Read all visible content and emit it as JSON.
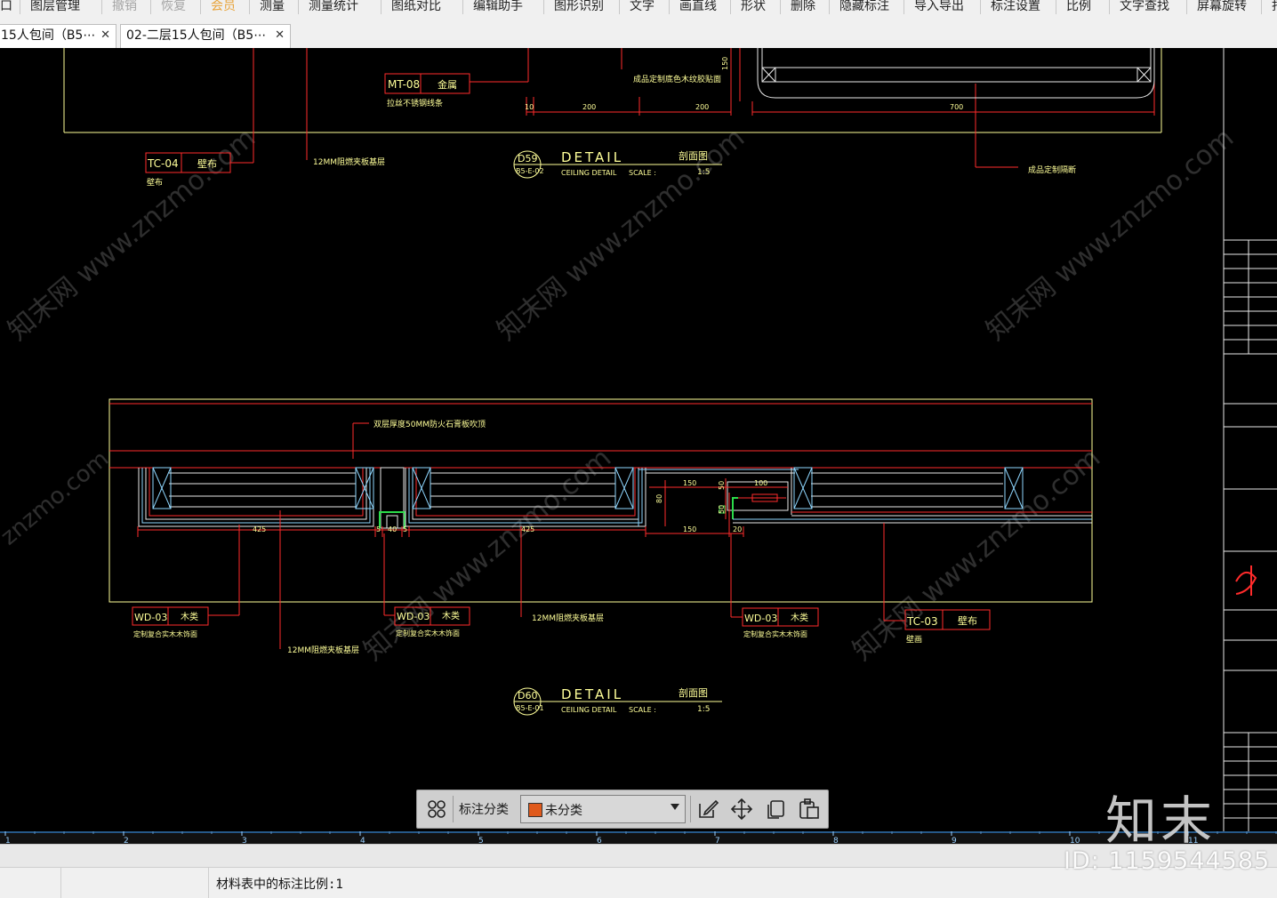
{
  "menu": {
    "items": [
      {
        "label": "口",
        "state": "normal"
      },
      {
        "label": "图层管理",
        "state": "normal"
      },
      {
        "label": "撤销",
        "state": "disabled"
      },
      {
        "label": "恢复",
        "state": "disabled"
      },
      {
        "label": "会员",
        "state": "accent"
      },
      {
        "label": "测量",
        "state": "normal"
      },
      {
        "label": "测量统计",
        "state": "normal"
      },
      {
        "label": "图纸对比",
        "state": "normal"
      },
      {
        "label": "编辑助手",
        "state": "normal"
      },
      {
        "label": "图形识别",
        "state": "normal"
      },
      {
        "label": "文字",
        "state": "normal"
      },
      {
        "label": "画直线",
        "state": "normal"
      },
      {
        "label": "形状",
        "state": "normal"
      },
      {
        "label": "删除",
        "state": "normal"
      },
      {
        "label": "隐藏标注",
        "state": "normal"
      },
      {
        "label": "导入导出",
        "state": "normal"
      },
      {
        "label": "标注设置",
        "state": "normal"
      },
      {
        "label": "比例",
        "state": "normal"
      },
      {
        "label": "文字查找",
        "state": "normal"
      },
      {
        "label": "屏幕旋转",
        "state": "normal"
      },
      {
        "label": "打",
        "state": "normal"
      }
    ]
  },
  "tabs": [
    {
      "label": "15人包间（B5⋯",
      "close": "✕"
    },
    {
      "label": "02-二层15人包间（B5⋯",
      "close": "✕"
    }
  ],
  "drawing": {
    "tags": [
      {
        "code": "MT-08",
        "material": "金属",
        "note": "拉丝不锈钢线条"
      },
      {
        "code": "TC-04",
        "material": "壁布",
        "note": "壁布"
      },
      {
        "code": "WD-03",
        "material": "木类",
        "note": "定制复合实木木饰面"
      },
      {
        "code": "WD-03",
        "material": "木类",
        "note": "定制复合实木木饰面"
      },
      {
        "code": "WD-03",
        "material": "木类",
        "note": "定制复合实木木饰面"
      },
      {
        "code": "TC-03",
        "material": "壁布",
        "note": "壁画"
      }
    ],
    "notes": {
      "plywood_12mm": "12MM阻燃夹板基层",
      "finished_top": "成品定制底色木纹胶贴面",
      "finished_right": "成品定制隔断",
      "mdf_note": "双层厚度50MM防火石膏板吹顶",
      "plywood_bottom": "12MM阻燃夹板基层"
    },
    "dims_top": [
      "10",
      "200",
      "200",
      "700",
      "150"
    ],
    "dims_bottom": [
      "425",
      "5",
      "40",
      "5",
      "425",
      "150",
      "100",
      "150",
      "50",
      "20",
      "80",
      "50"
    ],
    "titles": [
      {
        "id": "D59",
        "sheet": "B5-E-02",
        "word": "DETAIL",
        "kind": "剖面图",
        "sub": "CEILING DETAIL",
        "scale_label": "SCALE :",
        "scale": "1:5"
      },
      {
        "id": "D60",
        "sheet": "B5-E-01",
        "word": "DETAIL",
        "kind": "剖面图",
        "sub": "CEILING DETAIL",
        "scale_label": "SCALE :",
        "scale": "1:5"
      }
    ],
    "watermark_text": "知末网 www.znzmo.com"
  },
  "ruler": {
    "ticks": [
      "1",
      "2",
      "3",
      "4",
      "5",
      "6",
      "7",
      "8",
      "9",
      "10",
      "11"
    ]
  },
  "toolbar": {
    "category_label": "标注分类",
    "selected": "未分类",
    "selected_color": "#e05a1c",
    "icons": [
      "grid-icon",
      "edit-icon",
      "move-icon",
      "copy-icon",
      "paste-icon"
    ]
  },
  "status": {
    "text": "材料表中的标注比例:1"
  },
  "watermark": {
    "brand": "知末",
    "id": "ID: 1159544585"
  },
  "colors": {
    "cad_red": "#ff2b2b",
    "cad_yellow": "#ffff99",
    "cad_white": "#e8e8e8",
    "cad_cyan": "#8fd7ff",
    "cad_green": "#2bdc4a"
  }
}
